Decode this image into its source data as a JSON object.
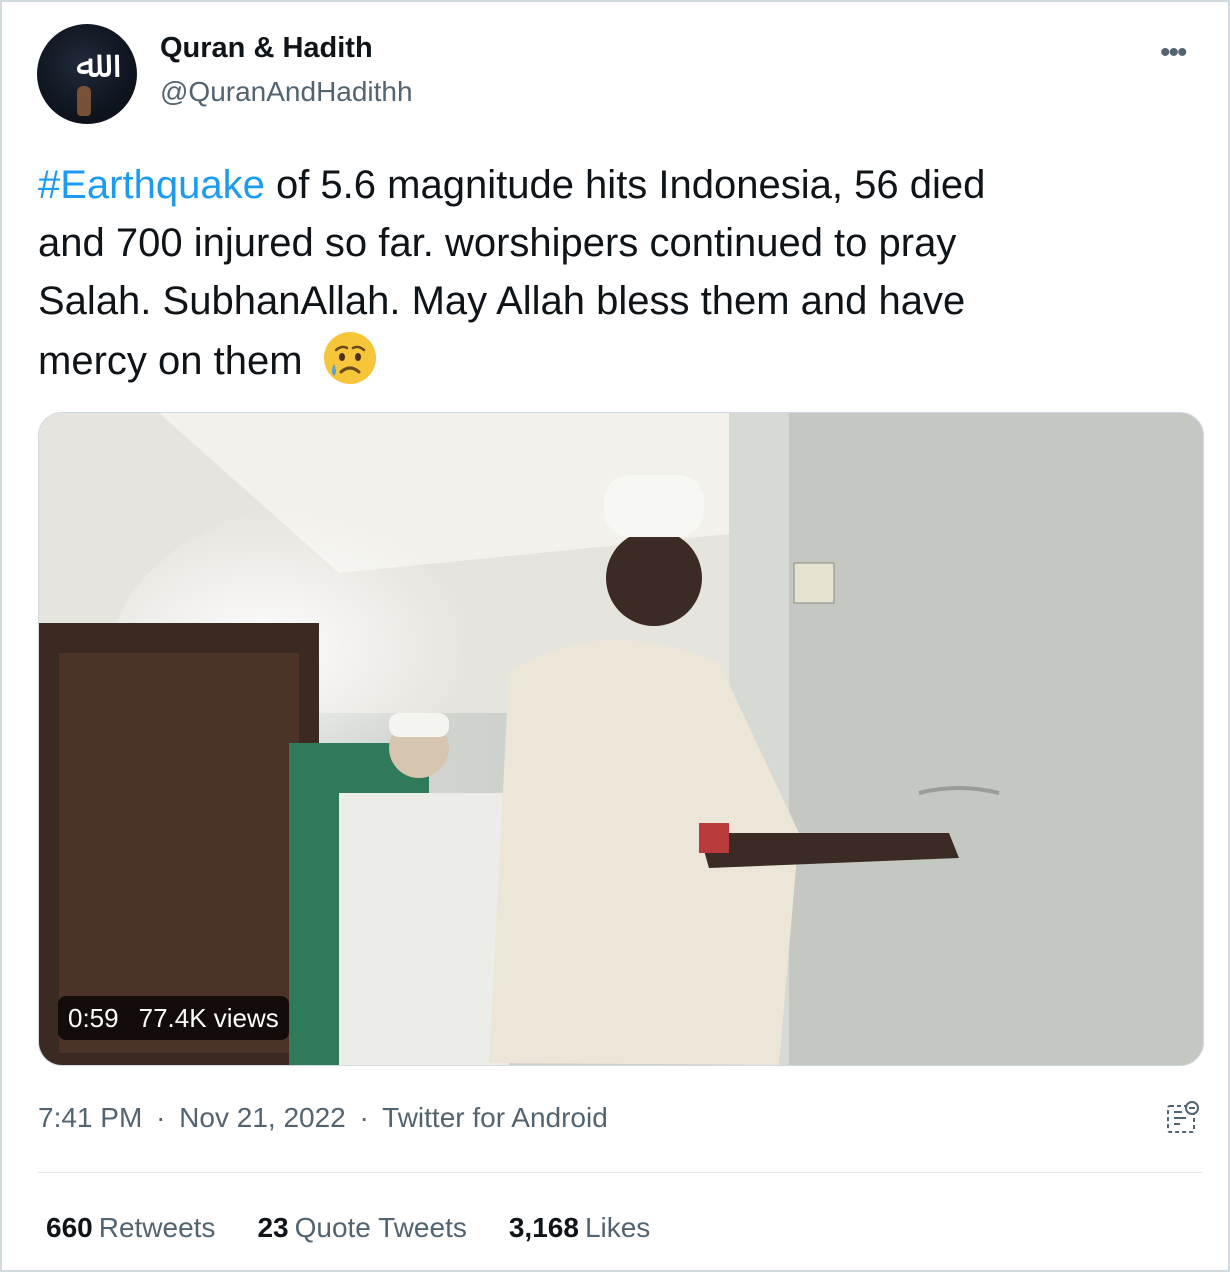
{
  "author": {
    "name": "Quran & Hadith",
    "handle": "@QuranAndHadithh",
    "avatar_icon": "allah-calligraphy-avatar"
  },
  "tweet": {
    "hashtag": "#Earthquake",
    "text_line1_rest": " of 5.6 magnitude hits Indonesia, 56 died",
    "text_line2": "and 700 injured so far.  worshipers continued to pray",
    "text_line3": "Salah. SubhanAllah. May Allah bless them and have",
    "text_line4": "mercy on them",
    "emoji": "crying-face-emoji"
  },
  "video": {
    "duration": "0:59",
    "views": "77.4K views"
  },
  "meta": {
    "time": "7:41 PM",
    "separator": "·",
    "date": "Nov 21, 2022",
    "source": "Twitter for Android"
  },
  "stats": {
    "retweets_count": "660",
    "retweets_label": "Retweets",
    "quotes_count": "23",
    "quotes_label": "Quote Tweets",
    "likes_count": "3,168",
    "likes_label": "Likes"
  },
  "colors": {
    "link": "#1d9bf0",
    "secondary_text": "#536471",
    "primary_text": "#0f1419"
  }
}
